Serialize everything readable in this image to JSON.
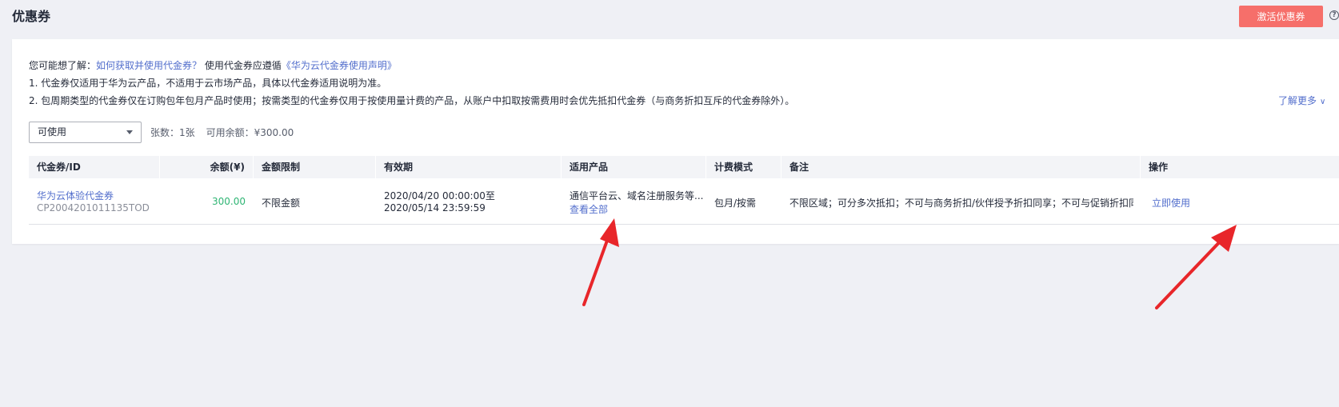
{
  "header": {
    "title": "优惠券",
    "activate_button": "激活优惠券",
    "help_icon": "question-circle-icon"
  },
  "tips": {
    "prefix": "您可能想了解：",
    "link1": "如何获取并使用代金券？",
    "mid": "使用代金券应遵循",
    "link2": "《华为云代金券使用声明》",
    "line1": "1. 代金券仅适用于华为云产品，不适用于云市场产品，具体以代金券适用说明为准。",
    "line2": "2. 包周期类型的代金券仅在订购包年包月产品时使用；按需类型的代金券仅用于按使用量计费的产品，从账户中扣取按需费用时会优先抵扣代金券（与商务折扣互斥的代金券除外）。",
    "learn_more": "了解更多"
  },
  "filter": {
    "status_selected": "可使用",
    "count_text": "张数：1张",
    "balance_text": "可用余额：¥300.00"
  },
  "table": {
    "columns": [
      "代金券/ID",
      "余额(¥)",
      "金额限制",
      "有效期",
      "适用产品",
      "计费模式",
      "备注",
      "操作"
    ],
    "rows": [
      {
        "name": "华为云体验代金券",
        "id": "CP2004201011135TOD",
        "amount": "300.00",
        "limit": "不限金额",
        "valid_from": "2020/04/20 00:00:00至",
        "valid_to": "2020/05/14 23:59:59",
        "products": "通信平台云、域名注册服务等...",
        "view_all": "查看全部",
        "billing_mode": "包月/按需",
        "remark": "不限区域；可分多次抵扣；不可与商务折扣/伙伴授予折扣同享；不可与促销折扣同享...",
        "action": "立即使用"
      }
    ]
  },
  "colors": {
    "accent": "#526ecc",
    "danger_button": "#f66f6a",
    "amount_green": "#2fb574",
    "arrow_red": "#e8262a"
  }
}
